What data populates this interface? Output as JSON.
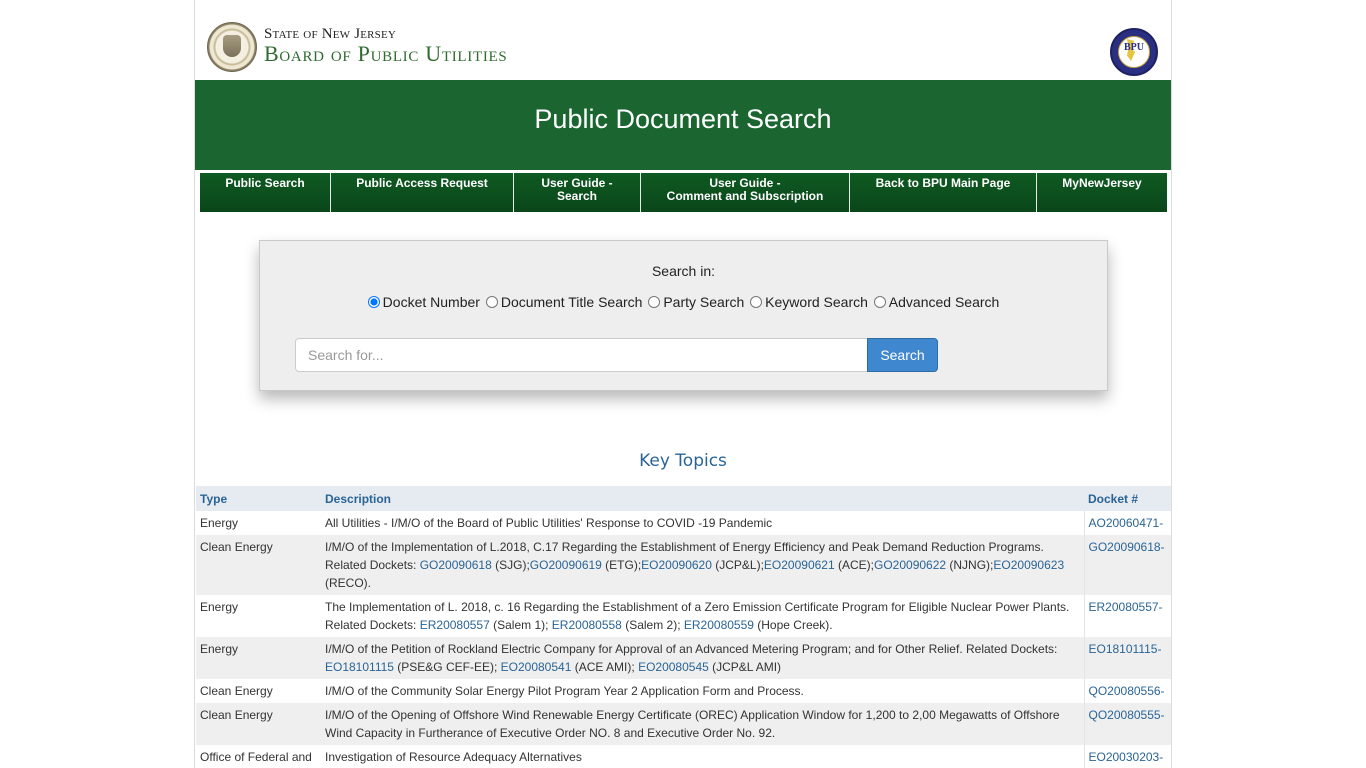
{
  "header": {
    "state_line": "State of New Jersey",
    "board_line": "Board of Public Utilities",
    "bpu_logo_text": "BPU"
  },
  "banner": {
    "title": "Public Document Search"
  },
  "nav": {
    "items": [
      {
        "line1": "Public Search",
        "line2": ""
      },
      {
        "line1": "Public Access Request",
        "line2": ""
      },
      {
        "line1": "User Guide -",
        "line2": "Search"
      },
      {
        "line1": "User Guide -",
        "line2": "Comment and Subscription"
      },
      {
        "line1": "Back to BPU Main Page",
        "line2": ""
      },
      {
        "line1": "MyNewJersey",
        "line2": ""
      }
    ]
  },
  "search": {
    "label": "Search in:",
    "options": [
      "Docket Number",
      "Document Title Search",
      "Party Search",
      "Keyword Search",
      "Advanced Search"
    ],
    "selected": "Docket Number",
    "placeholder": "Search for...",
    "value": "",
    "button": "Search"
  },
  "topics": {
    "title": "Key Topics",
    "headers": {
      "type": "Type",
      "description": "Description",
      "docket": "Docket #"
    },
    "rows": [
      {
        "type": "Energy",
        "desc": [
          {
            "t": "All Utilities - I/M/O of the Board of Public Utilities' Response to COVID -19 Pandemic"
          }
        ],
        "docket": "AO20060471-"
      },
      {
        "type": "Clean Energy",
        "desc": [
          {
            "t": "I/M/O of the Implementation of L.2018, C.17 Regarding the Establishment of Energy Efficiency and Peak Demand Reduction Programs. Related Dockets: "
          },
          {
            "l": "GO20090618"
          },
          {
            "t": " (SJG);"
          },
          {
            "l": "GO20090619"
          },
          {
            "t": " (ETG);"
          },
          {
            "l": "EO20090620"
          },
          {
            "t": " (JCP&L);"
          },
          {
            "l": "EO20090621"
          },
          {
            "t": " (ACE);"
          },
          {
            "l": "GO20090622"
          },
          {
            "t": " (NJNG);"
          },
          {
            "l": "EO20090623"
          },
          {
            "t": " (RECO)."
          }
        ],
        "docket": "GO20090618-"
      },
      {
        "type": "Energy",
        "desc": [
          {
            "t": "The Implementation of L. 2018, c. 16 Regarding the Establishment of a Zero Emission Certificate Program for Eligible Nuclear Power Plants. Related Dockets: "
          },
          {
            "l": "ER20080557"
          },
          {
            "t": " (Salem 1); "
          },
          {
            "l": "ER20080558"
          },
          {
            "t": " (Salem 2); "
          },
          {
            "l": "ER20080559"
          },
          {
            "t": " (Hope Creek)."
          }
        ],
        "docket": "ER20080557-"
      },
      {
        "type": "Energy",
        "desc": [
          {
            "t": "I/M/O of the Petition of Rockland Electric Company for Approval of an Advanced Metering Program; and for Other Relief. Related Dockets: "
          },
          {
            "l": "EO18101115"
          },
          {
            "t": " (PSE&G CEF-EE); "
          },
          {
            "l": "EO20080541"
          },
          {
            "t": " (ACE AMI); "
          },
          {
            "l": "EO20080545"
          },
          {
            "t": " (JCP&L AMI)"
          }
        ],
        "docket": "EO18101115-"
      },
      {
        "type": "Clean Energy",
        "desc": [
          {
            "t": "I/M/O of the Community Solar Energy Pilot Program Year 2 Application Form and Process."
          }
        ],
        "docket": "QO20080556-"
      },
      {
        "type": "Clean Energy",
        "desc": [
          {
            "t": "I/M/O of the Opening of Offshore Wind Renewable Energy Certificate (OREC) Application Window for 1,200 to 2,00 Megawatts of Offshore Wind Capacity in Furtherance of Executive Order NO. 8 and Executive Order No. 92."
          }
        ],
        "docket": "QO20080555-"
      },
      {
        "type": "Office of Federal and",
        "desc": [
          {
            "t": "Investigation of Resource Adequacy Alternatives"
          }
        ],
        "docket": "EO20030203-"
      }
    ]
  }
}
